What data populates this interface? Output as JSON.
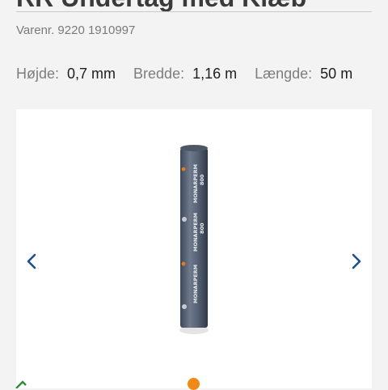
{
  "product": {
    "title": "RR Undertag med Klæb",
    "sku": "Varenr. 9220 1910997",
    "specs": [
      {
        "label": "Højde:",
        "value": "0,7 mm"
      },
      {
        "label": "Bredde:",
        "value": "1,16 m"
      },
      {
        "label": "Længde:",
        "value": "50 m"
      }
    ]
  },
  "gallery": {
    "roll_text": [
      "MONARPERM",
      "800"
    ],
    "prev_icon": "chevron-left-icon",
    "next_icon": "chevron-right-icon",
    "active_dot_color": "#ef8a17"
  }
}
